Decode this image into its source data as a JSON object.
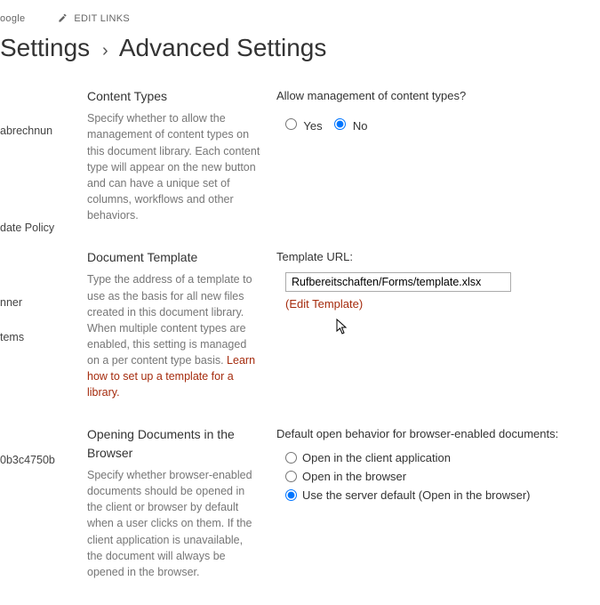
{
  "nav": {
    "oogle": "oogle",
    "edit_links": "EDIT LINKS"
  },
  "breadcrumb": {
    "parent": "Settings",
    "sep": "›",
    "current": "Advanced Settings"
  },
  "leftnav": {
    "item1": "abrechnun",
    "item2": "date Policy",
    "item3": "nner",
    "item4": "tems",
    "item5": "0b3c4750b"
  },
  "sections": {
    "content_types": {
      "title": "Content Types",
      "desc": "Specify whether to allow the management of content types on this document library. Each content type will appear on the new button and can have a unique set of columns, workflows and other behaviors.",
      "question": "Allow management of content types?",
      "yes": "Yes",
      "no": "No"
    },
    "doc_template": {
      "title": "Document Template",
      "desc_pre": "Type the address of a template to use as the basis for all new files created in this document library. When multiple content types are enabled, this setting is managed on a per content type basis. ",
      "desc_link": "Learn how to set up a template for a library.",
      "label": "Template URL:",
      "value": "Rufbereitschaften/Forms/template.xlsx",
      "edit": "(Edit Template)"
    },
    "opening": {
      "title": "Opening Documents in the Browser",
      "desc": "Specify whether browser-enabled documents should be opened in the client or browser by default when a user clicks on them. If the client application is unavailable, the document will always be opened in the browser.",
      "label": "Default open behavior for browser-enabled documents:",
      "opt1": "Open in the client application",
      "opt2": "Open in the browser",
      "opt3": "Use the server default (Open in the browser)"
    }
  }
}
